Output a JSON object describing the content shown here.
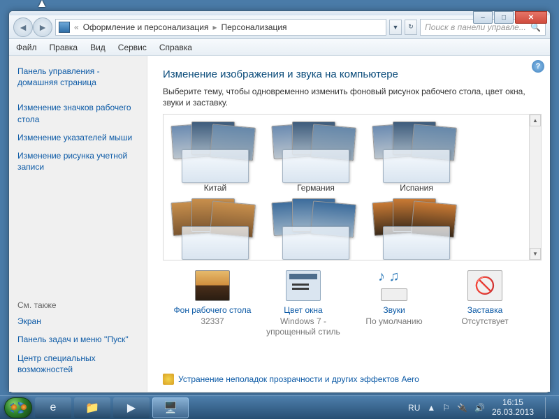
{
  "window": {
    "min": "–",
    "max": "□",
    "close": "✕"
  },
  "nav": {
    "back_icon": "◄",
    "fwd_icon": "►",
    "chev": "«",
    "crumb1": "Оформление и персонализация",
    "crumb2": "Персонализация",
    "search_placeholder": "Поиск в панели управле...",
    "search_icon": "🔍"
  },
  "menu": {
    "file": "Файл",
    "edit": "Правка",
    "view": "Вид",
    "tools": "Сервис",
    "help": "Справка"
  },
  "side": {
    "home": "Панель управления - домашняя страница",
    "l1": "Изменение значков рабочего стола",
    "l2": "Изменение указателей мыши",
    "l3": "Изменение рисунка учетной записи",
    "see": "См. также",
    "s1": "Экран",
    "s2": "Панель задач и меню ''Пуск''",
    "s3": "Центр специальных возможностей"
  },
  "main": {
    "help": "?",
    "title": "Изменение изображения и звука на компьютере",
    "desc": "Выберите тему, чтобы одновременно изменить фоновый рисунок рабочего стола, цвет окна, звуки и заставку.",
    "themes": [
      "Китай",
      "Германия",
      "Испания"
    ],
    "aero_link": "Устранение неполадок прозрачности и других эффектов Aero"
  },
  "settings": {
    "bg": {
      "label": "Фон рабочего стола",
      "value": "32337"
    },
    "wc": {
      "label": "Цвет окна",
      "value": "Windows 7 - упрощенный стиль"
    },
    "snd": {
      "label": "Звуки",
      "value": "По умолчанию"
    },
    "scr": {
      "label": "Заставка",
      "value": "Отсутствует"
    }
  },
  "tray": {
    "lang": "RU",
    "up": "▲",
    "time": "16:15",
    "date": "26.03.2013"
  }
}
